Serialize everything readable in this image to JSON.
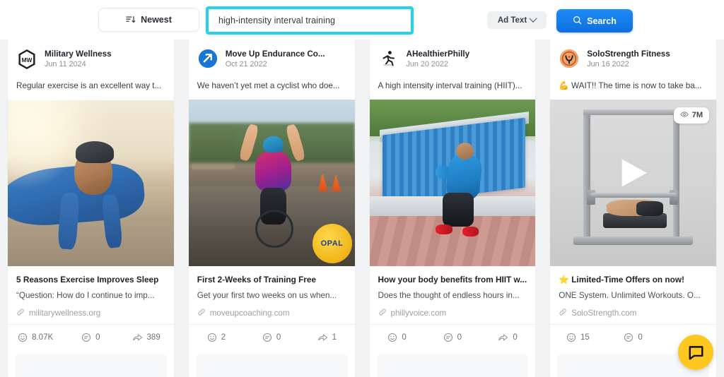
{
  "toolbar": {
    "sort_label": "Newest",
    "sort_icon": "sort-descending-icon",
    "search_value": "high-intensity interval training",
    "search_placeholder": "Search",
    "filter_label": "Ad Text",
    "search_button_label": "Search",
    "highlight_color": "#22d3ee",
    "search_button_color": "#1580ee"
  },
  "cards": [
    {
      "brand": "Military Wellness",
      "date": "Jun 11 2024",
      "avatar_icon": "military-wellness-logo",
      "caption": "Regular exercise is an excellent way t...",
      "media_type": "image",
      "title": "5 Reasons Exercise Improves Sleep",
      "description": "“Question: How do I continue to imp...",
      "url": "militarywellness.org",
      "stats": {
        "reactions": "8.07K",
        "comments": "0",
        "shares": "389"
      }
    },
    {
      "brand": "Move Up Endurance Co...",
      "date": "Oct 21 2022",
      "avatar_icon": "move-up-arrow-logo",
      "caption": "We haven’t yet met a cyclist who doe...",
      "media_type": "image",
      "media_badge": "OPAL",
      "title": "First 2-Weeks of Training Free",
      "description": "Get your first two weeks on us when...",
      "url": "moveupcoaching.com",
      "stats": {
        "reactions": "2",
        "comments": "0",
        "shares": "1"
      }
    },
    {
      "brand": "AHealthierPhilly",
      "date": "Jun 20 2022",
      "avatar_icon": "running-person-logo",
      "caption": "A high intensity interval training (HIIT)...",
      "media_type": "image",
      "title": "How your body benefits from HIIT w...",
      "description": "Does the thought of endless hours in...",
      "url": "phillyvoice.com",
      "stats": {
        "reactions": "0",
        "comments": "0",
        "shares": "0"
      }
    },
    {
      "brand": "SoloStrength Fitness",
      "date": "Jun 16 2022",
      "avatar_icon": "solostrength-logo",
      "caption": "💪 WAIT!! The time is now to take ba...",
      "media_type": "video",
      "view_count": "7M",
      "view_icon": "eye-icon",
      "title": "⭐ Limited-Time Offers on now!",
      "description": "ONE System. Unlimited Workouts. O...",
      "url": "SoloStrength.com",
      "stats": {
        "reactions": "15",
        "comments": "0"
      }
    }
  ],
  "chat_widget": {
    "icon": "chat-bubble-icon",
    "color": "#ffc821"
  }
}
